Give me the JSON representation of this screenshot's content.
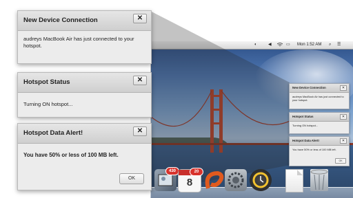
{
  "menubar": {
    "clock": "Mon 1:52 AM"
  },
  "popups": {
    "connection": {
      "title": "New Device Connection",
      "close_label": "✕",
      "message": "audreys MacBook Air has just connected to your hotspot."
    },
    "status": {
      "title": "Hotspot Status",
      "close_label": "✕",
      "message": "Turning ON hotspot..."
    },
    "alert": {
      "title": "Hotspot Data Alert!",
      "close_label": "✕",
      "message": "You have 50% or less of 100 MB left.",
      "ok_label": "OK"
    }
  },
  "mini_popups": {
    "connection": {
      "title": "New Device Connection",
      "close_label": "✕",
      "message": "audreys MacBook Air has just connected to your hotspot."
    },
    "status": {
      "title": "Hotspot Status",
      "close_label": "✕",
      "message": "Turning ON hotspot..."
    },
    "alert": {
      "title": "Hotspot Data Alert!",
      "close_label": "✕",
      "message": "You have 50% or less of 100 MB left.",
      "ok_label": "OK"
    }
  },
  "dock": {
    "items": [
      {
        "name": "photos",
        "badge": "430"
      },
      {
        "name": "calendar",
        "label": "8",
        "badge": "20"
      },
      {
        "name": "media"
      },
      {
        "name": "system-preferences"
      },
      {
        "name": "time-machine"
      },
      {
        "name": "document"
      },
      {
        "name": "trash"
      }
    ]
  },
  "colors": {
    "popup_bg": "#ececec",
    "title_bar": "#d4d4d4",
    "badge": "#d8322c"
  }
}
